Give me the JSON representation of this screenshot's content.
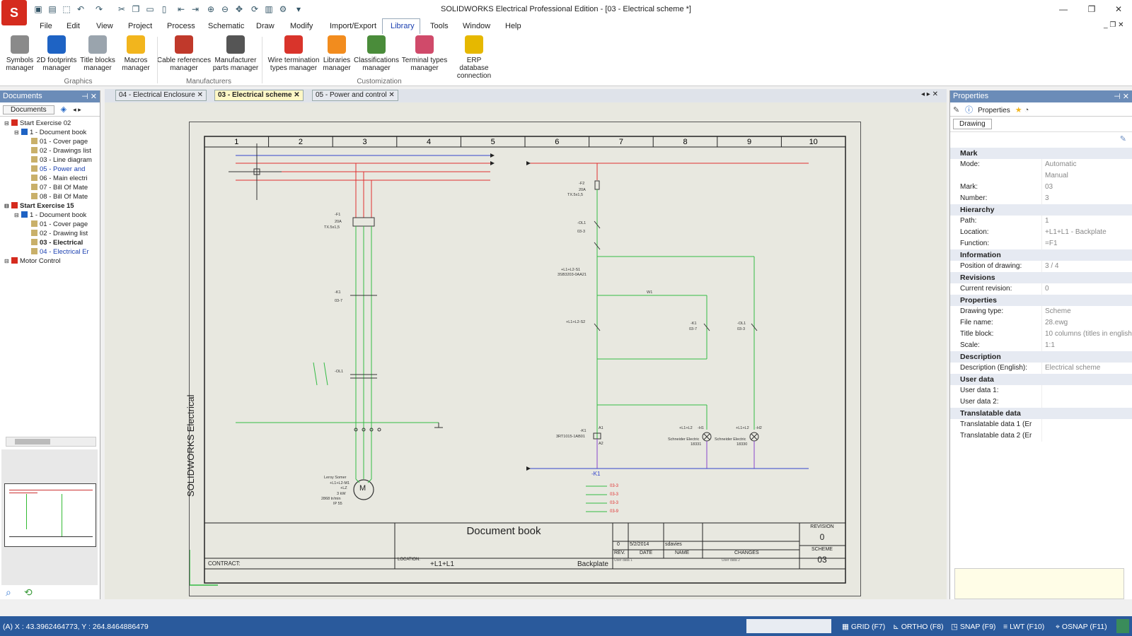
{
  "window": {
    "title": "SOLIDWORKS Electrical Professional Edition - [03 - Electrical scheme *]",
    "logo_text": "S"
  },
  "menu": [
    "File",
    "Edit",
    "View",
    "Project",
    "Process",
    "Schematic",
    "Draw",
    "Modify",
    "Import/Export",
    "Library",
    "Tools",
    "Window",
    "Help"
  ],
  "ribbon": {
    "buttons": [
      {
        "label1": "Symbols",
        "label2": "manager",
        "icon": "symbols-icon",
        "color": "#8a8a8a"
      },
      {
        "label1": "2D footprints",
        "label2": "manager",
        "icon": "footprint-icon",
        "color": "#1e63c4"
      },
      {
        "label1": "Title blocks",
        "label2": "manager",
        "icon": "titleblock-icon",
        "color": "#9aa4ad"
      },
      {
        "label1": "Macros",
        "label2": "manager",
        "icon": "star-icon",
        "color": "#f2b51d"
      },
      {
        "label1": "Cable references",
        "label2": "manager",
        "icon": "cable-icon",
        "color": "#c0392b"
      },
      {
        "label1": "Manufacturer",
        "label2": "parts manager",
        "icon": "wrench-icon",
        "color": "#555555"
      },
      {
        "label1": "Wire termination",
        "label2": "types manager",
        "icon": "wire-icon",
        "color": "#d9342b"
      },
      {
        "label1": "Libraries",
        "label2": "manager",
        "icon": "library-icon",
        "color": "#f28c1e"
      },
      {
        "label1": "Classifications",
        "label2": "manager",
        "icon": "classification-icon",
        "color": "#4a8c3a"
      },
      {
        "label1": "Terminal types",
        "label2": "manager",
        "icon": "terminal-icon",
        "color": "#d04a6a"
      },
      {
        "label1": "ERP database",
        "label2": "connection",
        "icon": "erp-icon",
        "color": "#e6b800"
      }
    ],
    "groups": [
      "Graphics",
      "Manufacturers",
      "Customization"
    ]
  },
  "documents": {
    "title": "Documents",
    "tab_label": "Documents",
    "tree": [
      {
        "text": "Start Exercise 02",
        "level": 0,
        "bold": false,
        "color": "#222"
      },
      {
        "text": "1 - Document book",
        "level": 1,
        "bold": false,
        "color": "#222"
      },
      {
        "text": "01 - Cover page",
        "level": 2,
        "bold": false,
        "color": "#222"
      },
      {
        "text": "02 - Drawings list",
        "level": 2,
        "bold": false,
        "color": "#222"
      },
      {
        "text": "03 - Line diagram",
        "level": 2,
        "bold": false,
        "color": "#222"
      },
      {
        "text": "05 - Power and",
        "level": 2,
        "bold": false,
        "color": "#1a3fb0"
      },
      {
        "text": "06 - Main electri",
        "level": 2,
        "bold": false,
        "color": "#222"
      },
      {
        "text": "07 - Bill Of Mate",
        "level": 2,
        "bold": false,
        "color": "#222"
      },
      {
        "text": "08 - Bill Of Mate",
        "level": 2,
        "bold": false,
        "color": "#222"
      },
      {
        "text": "Start Exercise 15",
        "level": 0,
        "bold": true,
        "color": "#222"
      },
      {
        "text": "1 - Document book",
        "level": 1,
        "bold": false,
        "color": "#222"
      },
      {
        "text": "01 - Cover page",
        "level": 2,
        "bold": false,
        "color": "#222"
      },
      {
        "text": "02 - Drawing list",
        "level": 2,
        "bold": false,
        "color": "#222"
      },
      {
        "text": "03 - Electrical",
        "level": 2,
        "bold": true,
        "color": "#222"
      },
      {
        "text": "04 - Electrical Er",
        "level": 2,
        "bold": false,
        "color": "#1a3fb0"
      },
      {
        "text": "Motor Control",
        "level": 0,
        "bold": false,
        "color": "#222"
      }
    ]
  },
  "tabs": [
    {
      "label": "04 - Electrical Enclosure",
      "active": false
    },
    {
      "label": "03 - Electrical scheme",
      "active": true
    },
    {
      "label": "05 - Power and control",
      "active": false
    }
  ],
  "schematic": {
    "columns": [
      "1",
      "2",
      "3",
      "4",
      "5",
      "6",
      "7",
      "8",
      "9",
      "10"
    ],
    "vertical_label": "SOLIDWORKS Electrical",
    "title_block": {
      "title": "Document book",
      "contract_label": "CONTRACT:",
      "location_label": "LOCATION:",
      "location_value": "+L1+L1",
      "backplate": "Backplate",
      "revision_label": "REVISION",
      "revision_value": "0",
      "scheme_label": "SCHEME",
      "scheme_value": "03",
      "rev_row": {
        "rev": "0",
        "date": "5/2/2014",
        "name": "sdavies"
      },
      "headers": {
        "rev": "REV.",
        "date": "DATE",
        "name": "NAME",
        "changes": "CHANGES"
      },
      "user_data_1": "User data 1",
      "user_data_2": "User data 2"
    },
    "labels": {
      "f1": "-F1",
      "f1_rating": "20A",
      "f1_model": "TX.5x1,5",
      "k1": "-K1",
      "k1_ref": "03-7",
      "ol1": "-OL1",
      "motor_maker": "Leroy Somer",
      "motor_tag": "+L1+L2-M1",
      "motor_sub": "+LZ",
      "motor_power": "3 kW",
      "motor_speed": "2868 tr/min",
      "motor_ip": "IP 55",
      "motor_symbol": "M",
      "f2": "-F2",
      "f2_rating": "20A",
      "f2_model": "TX.5x1,5",
      "ol1_ctrl": "-OL1",
      "ol1_ctrl_ref": "03-3",
      "s1": "+L1+L2-S1",
      "s1_model": "3SB3203-0AA21",
      "s2": "+L1+L2-S2",
      "k1_ctrl": "-K1",
      "k1_ctrl_ref": "03-7",
      "ol1_right": "-OL1",
      "ol1_right_ref": "03-3",
      "k1_coil": "-K1",
      "k1_coil_model": "3RT1015-1AB01",
      "a1": "A1",
      "a2": "A2",
      "h1": "+L1+L2",
      "h1_tag": "-H1",
      "h1_maker": "Schneider Electric",
      "h1_ref": "18331",
      "h2": "+L1+L2",
      "h2_tag": "-H2",
      "h2_maker": "Schneider Electric",
      "h2_ref": "18330",
      "k1_bottom": "-K1",
      "wire_label": "W1",
      "xref_list": [
        "03-3",
        "03-3",
        "03-3",
        "03-9"
      ]
    }
  },
  "properties": {
    "title": "Properties",
    "tab_label": "Properties",
    "subtab": "Drawing",
    "sections": [
      {
        "name": "Mark",
        "rows": [
          {
            "key": "Mode:",
            "val": "Automatic"
          },
          {
            "key": "",
            "val": "Manual"
          },
          {
            "key": "Mark:",
            "val": "03"
          },
          {
            "key": "Number:",
            "val": "3"
          }
        ]
      },
      {
        "name": "Hierarchy",
        "rows": [
          {
            "key": "Path:",
            "val": "1"
          },
          {
            "key": "Location:",
            "val": "+L1+L1 - Backplate"
          },
          {
            "key": "Function:",
            "val": "=F1"
          }
        ]
      },
      {
        "name": "Information",
        "rows": [
          {
            "key": "Position of drawing:",
            "val": "3 / 4"
          }
        ]
      },
      {
        "name": "Revisions",
        "rows": [
          {
            "key": "Current revision:",
            "val": "0"
          }
        ]
      },
      {
        "name": "Properties",
        "rows": [
          {
            "key": "Drawing type:",
            "val": "Scheme"
          },
          {
            "key": "File name:",
            "val": "28.ewg"
          },
          {
            "key": "Title block:",
            "val": "10 columns (titles in english"
          },
          {
            "key": "Scale:",
            "val": "1:1"
          }
        ]
      },
      {
        "name": "Description",
        "rows": [
          {
            "key": "Description (English):",
            "val": "Electrical scheme"
          }
        ]
      },
      {
        "name": "User data",
        "rows": [
          {
            "key": "User data 1:",
            "val": ""
          },
          {
            "key": "User data 2:",
            "val": ""
          }
        ]
      },
      {
        "name": "Translatable data",
        "rows": [
          {
            "key": "Translatable data 1 (Er",
            "val": ""
          },
          {
            "key": "Translatable data 2 (Er",
            "val": ""
          }
        ]
      }
    ]
  },
  "status": {
    "coords": "(A) X : 43.3962464773, Y : 264.8464886479",
    "grid": "GRID (F7)",
    "ortho": "ORTHO (F8)",
    "snap": "SNAP (F9)",
    "lwt": "LWT (F10)",
    "osnap": "OSNAP (F11)"
  },
  "colors": {
    "ribbon_accent": "#1e63c4",
    "panel_head": "#6b8cb8",
    "status": "#2a5a9c",
    "wire_red": "#e03030",
    "wire_green": "#33bb44",
    "wire_blue": "#3344cc",
    "wire_purple": "#8844cc"
  }
}
